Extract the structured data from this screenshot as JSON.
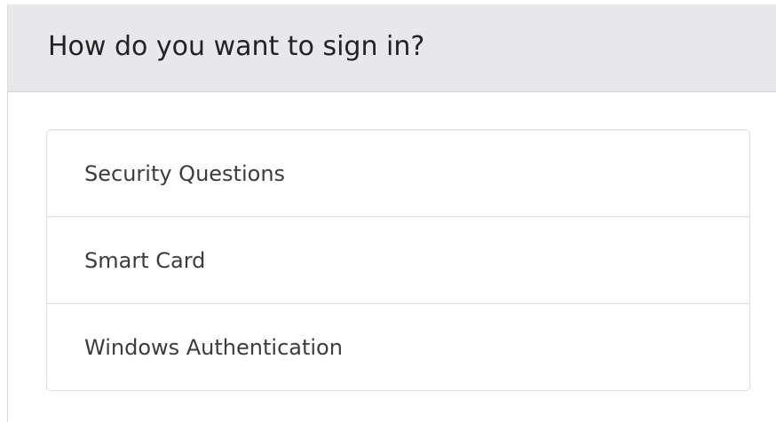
{
  "header": {
    "title": "How do you want to sign in?"
  },
  "options": [
    {
      "label": "Security Questions"
    },
    {
      "label": "Smart Card"
    },
    {
      "label": "Windows Authentication"
    }
  ],
  "colors": {
    "header_background": "#e8e8ec",
    "border": "#dddddd",
    "text": "#3c3c3c",
    "title_text": "#222222"
  }
}
